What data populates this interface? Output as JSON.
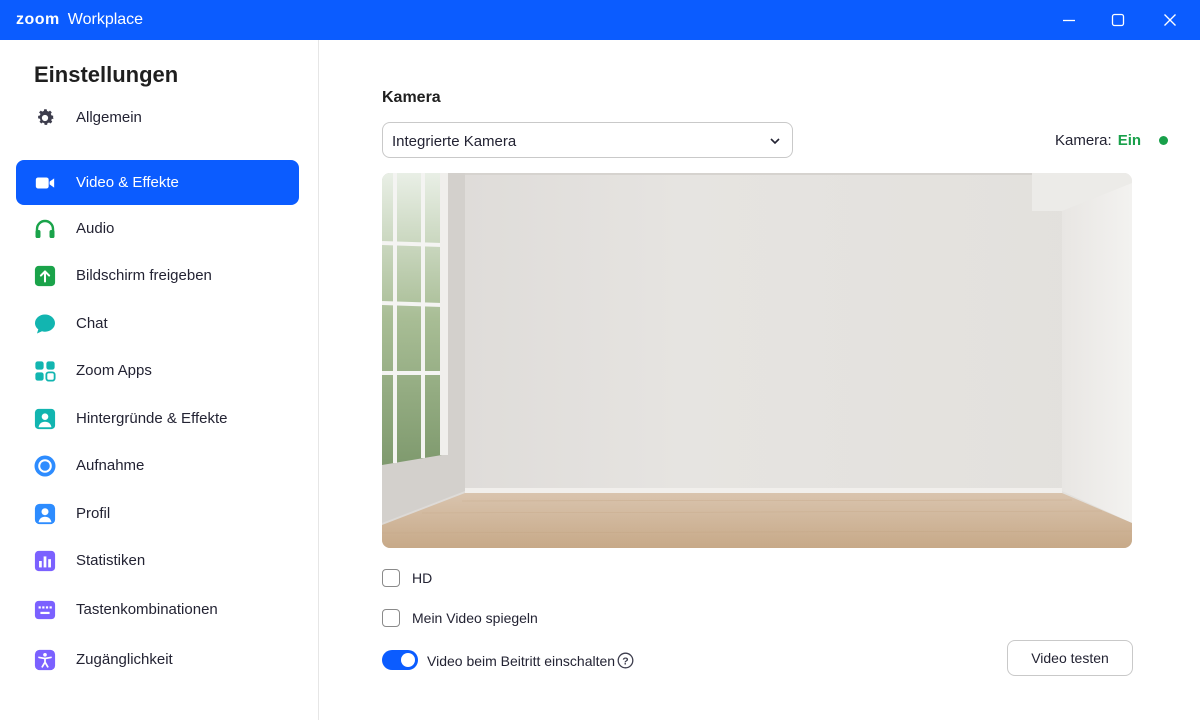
{
  "titlebar": {
    "brand_zoom": "zoom",
    "brand_product": "Workplace",
    "controls": [
      "minimize-icon",
      "maximize-icon",
      "close-icon"
    ]
  },
  "sidebar": {
    "title": "Einstellungen",
    "active_index": 1,
    "items": [
      {
        "label": "Allgemein",
        "icon": "gear-icon",
        "color": "#3d3d4d"
      },
      {
        "label": "Video & Effekte",
        "icon": "video-camera-icon",
        "color": "#ffffff"
      },
      {
        "label": "Audio",
        "icon": "headphones-icon",
        "color": "#1aa34a"
      },
      {
        "label": "Bildschirm freigeben",
        "icon": "share-screen-icon",
        "color": "#1aa34a"
      },
      {
        "label": "Chat",
        "icon": "chat-bubble-icon",
        "color": "#12b5b0"
      },
      {
        "label": "Zoom Apps",
        "icon": "apps-grid-icon",
        "color": "#12b5b0"
      },
      {
        "label": "Hintergründe & Effekte",
        "icon": "background-person-icon",
        "color": "#12b5b0"
      },
      {
        "label": "Aufnahme",
        "icon": "record-icon",
        "color": "#2d8cff"
      },
      {
        "label": "Profil",
        "icon": "profile-icon",
        "color": "#2d8cff"
      },
      {
        "label": "Statistiken",
        "icon": "statistics-icon",
        "color": "#7b61ff"
      },
      {
        "label": "Tastenkombinationen",
        "icon": "keyboard-icon",
        "color": "#7b61ff"
      },
      {
        "label": "Zugänglichkeit",
        "icon": "accessibility-icon",
        "color": "#7b61ff"
      }
    ]
  },
  "camera": {
    "section_title": "Kamera",
    "selected_device": "Integrierte Kamera",
    "status_label": "Kamera:",
    "status_value": "Ein",
    "status_color": "#18a04a"
  },
  "options": {
    "hd_label": "HD",
    "hd_checked": false,
    "mirror_label": "Mein Video spiegeln",
    "mirror_checked": false,
    "join_video_label": "Video beim Beitritt einschalten",
    "join_video_on": true
  },
  "actions": {
    "test_video_label": "Video testen"
  },
  "colors": {
    "accent": "#0b5cff"
  }
}
